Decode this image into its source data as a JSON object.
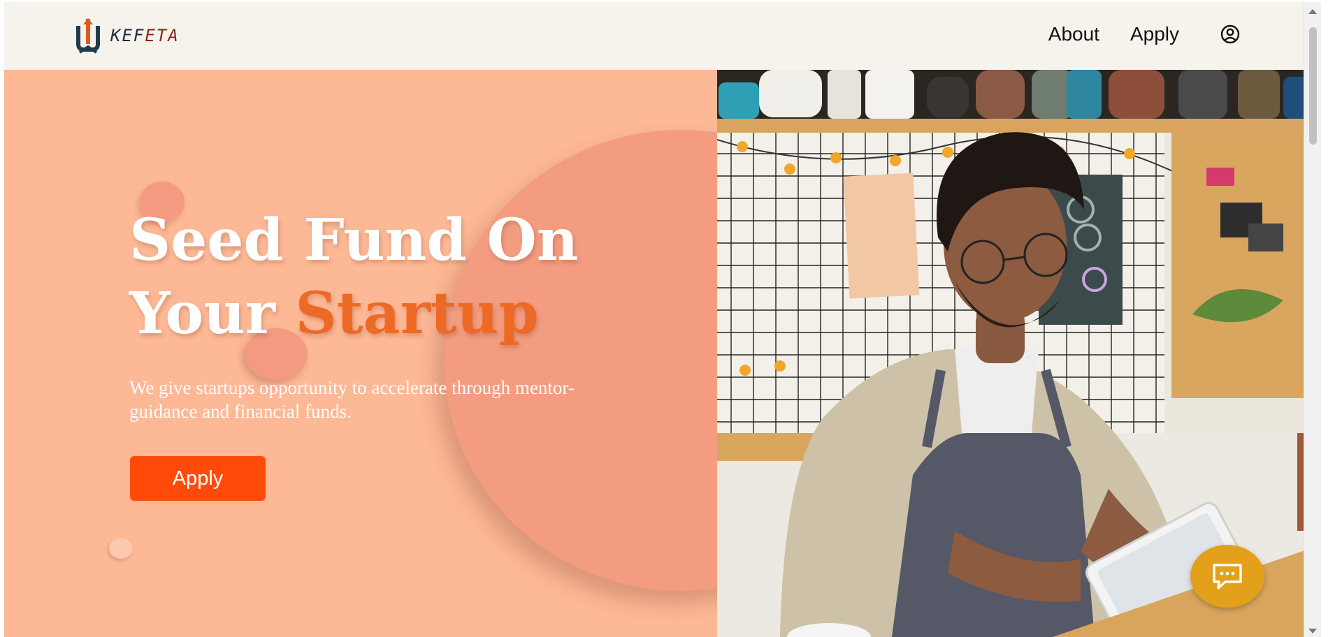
{
  "brand": {
    "name_prefix": "KEF",
    "name_suffix": "ETA",
    "accent_color": "#8b2416"
  },
  "nav": {
    "about_label": "About",
    "apply_label": "Apply",
    "account_icon": "user-circle-icon"
  },
  "hero": {
    "headline_line1": "Seed Fund On",
    "headline_line2_prefix": "Your ",
    "headline_highlight": "Startup",
    "subtitle": "We give startups opportunity to accelerate through mentor-guidance and financial funds.",
    "cta_label": "Apply",
    "background_color": "#fdb895",
    "circle_color": "#f39c80",
    "highlight_color": "#ed6a26",
    "button_color": "#ff4a0a"
  },
  "chat": {
    "icon": "chat-bubble-icon",
    "color": "#e3a01a"
  }
}
